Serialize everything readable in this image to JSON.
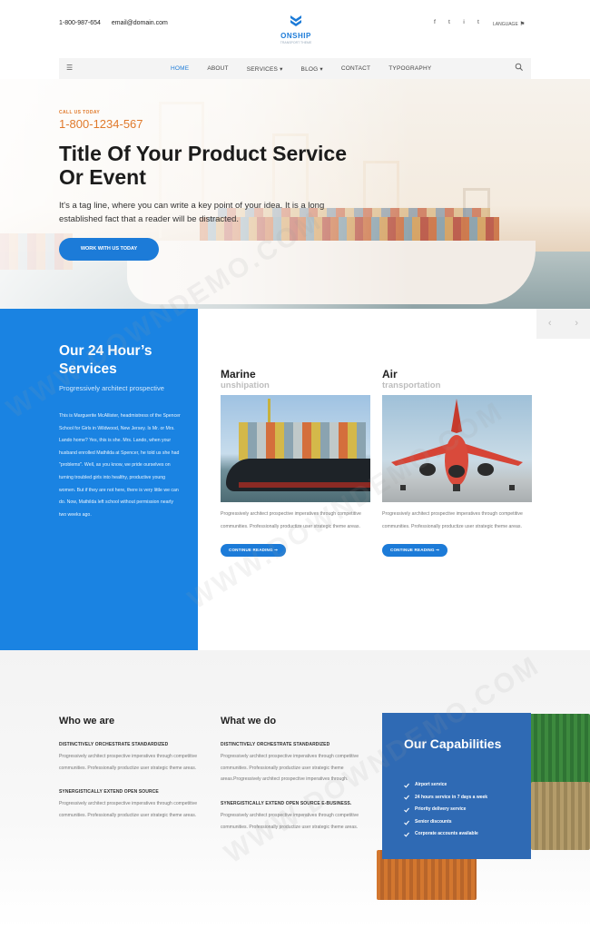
{
  "header": {
    "phone": "1-800-987-654",
    "email": "email@domain.com",
    "logo": {
      "name": "ONSHIP",
      "tagline": "TRANSPORT THEME"
    },
    "social": [
      "f",
      "t",
      "i",
      "t"
    ],
    "language": {
      "label": "LANGUAGE",
      "icon": "flag-icon"
    }
  },
  "nav": {
    "items": [
      {
        "label": "HOME",
        "active": true
      },
      {
        "label": "ABOUT"
      },
      {
        "label": "SERVICES ▾"
      },
      {
        "label": "BLOG ▾"
      },
      {
        "label": "CONTACT"
      },
      {
        "label": "TYPOGRAPHY"
      }
    ]
  },
  "hero": {
    "call_label": "CALL US TODAY",
    "phone": "1-800-1234-567",
    "title": "Title Of Your Product Service Or Event",
    "tagline": "It's a tag line, where you can write a key point of your idea. It is a long established fact that a reader will be distracted.",
    "cta": "WORK WITH US TODAY"
  },
  "services": {
    "title": "Our 24 Hour’s Services",
    "subtitle": "Progressively architect prospective",
    "body": "This is Marguerite McAllister, headmistress of the Spencer School for Girls in Wildwood, New Jersey. Is Mr. or Mrs. Lando home? Yes, this is she. Mrs. Lando, when your husband enrolled Mathilda at Spencer, he told us she had \"problems\". Well, as you know, we pride ourselves on turning troubled girls into healthy, productive young women. But if they are not here, there is very little we can do. Now, Mathilda left school without permission nearly two weeks ago.",
    "cards": [
      {
        "title": "Marine",
        "subtitle": "unshipation",
        "text": "Progressively architect prospective imperatives through competitive communities. Professionally productize user strategic theme areas.",
        "button": "CONTINUE READING ➞"
      },
      {
        "title": "Air",
        "subtitle": "transportation",
        "text": "Progressively architect prospective imperatives through competitive communities. Professionally productize user strategic theme areas.",
        "button": "CONTINUE READING ➞"
      }
    ],
    "arrows": {
      "prev": "‹",
      "next": "›"
    }
  },
  "who": {
    "title": "Who we are",
    "items": [
      {
        "head": "DISTINCTIVELY ORCHESTRATE STANDARDIZED",
        "text": "Progressively architect prospective imperatives through competitive communities. Professionally productize user strategic theme areas."
      },
      {
        "head": "SYNERGISTICALLY EXTEND OPEN SOURCE",
        "text": "Progressively architect prospective imperatives through competitive communities. Professionally productize user strategic theme areas."
      }
    ]
  },
  "what": {
    "title": "What we do",
    "items": [
      {
        "head": "DISTINCTIVELY ORCHESTRATE STANDARDIZED",
        "text": "Progressively architect prospective imperatives through competitive communities. Professionally productize user strategic theme areas.Progressively architect prospective imperatives through."
      },
      {
        "head": "SYNERGISTICALLY EXTEND OPEN SOURCE E-BUSINESS.",
        "text": "Progressively architect prospective imperatives through competitive communities. Professionally productize user strategic theme areas."
      }
    ]
  },
  "capabilities": {
    "title": "Our Capabilities",
    "items": [
      "Airport service",
      "24 hours service in 7 days a week",
      "Priority delivery service",
      "Senior discounts",
      "Corporate accounts available"
    ]
  },
  "watermark": "WWW.DOWNDEMO.COM",
  "colors": {
    "accent": "#1c7bd8",
    "orange": "#e07a2c",
    "capabilities": "#2f6ab4"
  }
}
